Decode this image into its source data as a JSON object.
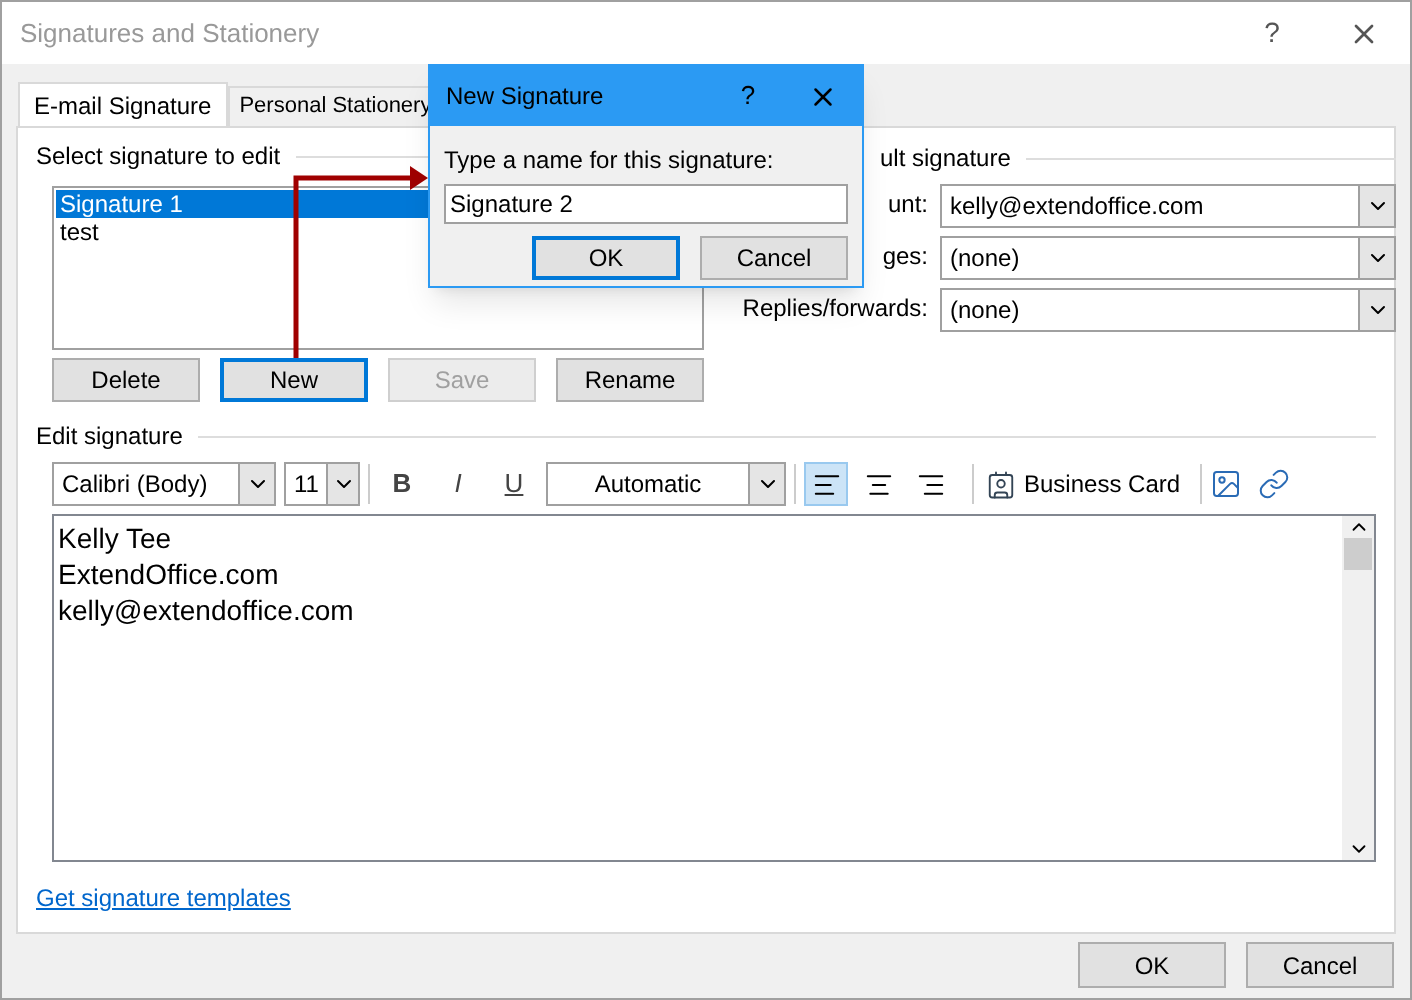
{
  "window": {
    "title": "Signatures and Stationery",
    "help": "?"
  },
  "tabs": [
    {
      "label": "E-mail Signature",
      "selected": true
    },
    {
      "label": "Personal Stationery",
      "selected": false
    }
  ],
  "select_heading": "Select signature to edit",
  "signatures": [
    {
      "name": "Signature 1",
      "selected": true
    },
    {
      "name": "test",
      "selected": false
    }
  ],
  "signature_buttons": [
    {
      "label": "Delete",
      "disabled": false,
      "focused": false
    },
    {
      "label": "New",
      "disabled": false,
      "focused": true
    },
    {
      "label": "Save",
      "disabled": true,
      "focused": false
    },
    {
      "label": "Rename",
      "disabled": false,
      "focused": false
    }
  ],
  "defaults": {
    "heading": "ult signature",
    "rows": [
      {
        "label": "unt:",
        "value": "kelly@extendoffice.com"
      },
      {
        "label": "ges:",
        "value": "(none)"
      },
      {
        "label": "Replies/forwards:",
        "value": "(none)"
      }
    ]
  },
  "edit_heading": "Edit signature",
  "toolbar": {
    "font": "Calibri (Body)",
    "size": "11",
    "styles": [
      {
        "label": "B",
        "kind": "bold"
      },
      {
        "label": "I",
        "kind": "italic"
      },
      {
        "label": "U",
        "kind": "underline"
      }
    ],
    "color_label": "Automatic",
    "align": [
      {
        "kind": "left",
        "selected": true
      },
      {
        "kind": "center",
        "selected": false
      },
      {
        "kind": "right",
        "selected": false
      }
    ],
    "business_card": "Business Card"
  },
  "body_lines": [
    "Kelly Tee",
    "ExtendOffice.com",
    "kelly@extendoffice.com"
  ],
  "templates_link": "Get signature templates",
  "footer_buttons": [
    {
      "label": "OK"
    },
    {
      "label": "Cancel"
    }
  ],
  "dialog": {
    "title": "New Signature",
    "help": "?",
    "prompt": "Type a name for this signature:",
    "value": "Signature 2",
    "buttons": [
      {
        "label": "OK",
        "default": true
      },
      {
        "label": "Cancel",
        "default": false
      }
    ]
  }
}
